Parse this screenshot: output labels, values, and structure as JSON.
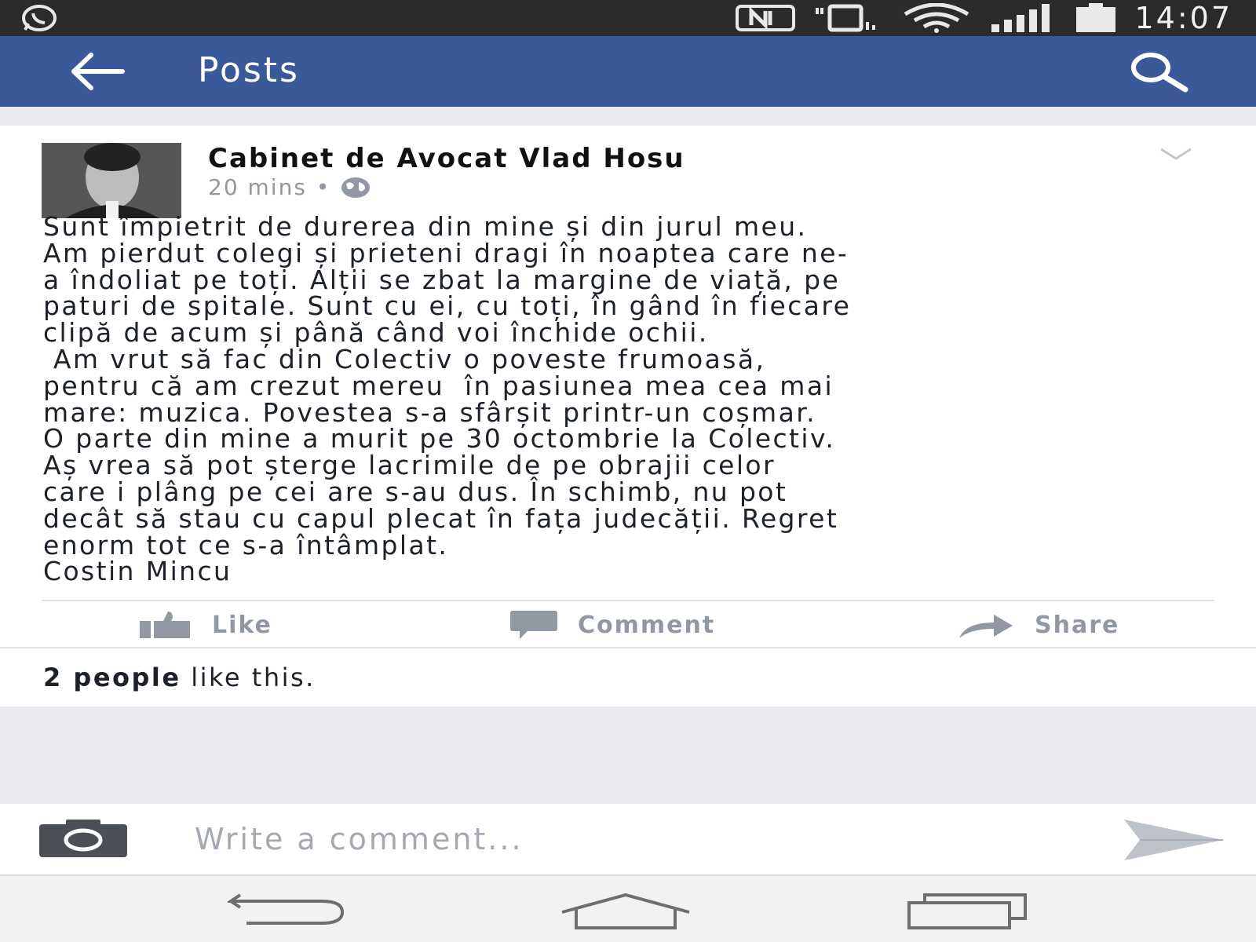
{
  "status_bar": {
    "time": "14:07",
    "icons": [
      "whatsapp-icon",
      "nfc-icon",
      "vibrate-icon",
      "wifi-icon",
      "signal-icon",
      "battery-icon"
    ]
  },
  "app_bar": {
    "title": "Posts",
    "color": "#3b5998"
  },
  "post": {
    "author": "Cabinet de Avocat Vlad Hosu",
    "time": "20 mins",
    "separator": "•",
    "body_lines": [
      "Sunt împietrit de durerea din mine și din jurul meu.",
      "Am pierdut colegi și prieteni dragi în noaptea care ne-",
      "a îndoliat pe toți. Alții se zbat la margine de viață, pe",
      "paturi de spitale. Sunt cu ei, cu toți, în gând în fiecare",
      "clipă de acum și până când voi închide ochii.",
      " Am vrut să fac din Colectiv o poveste frumoasă,",
      "pentru că am crezut mereu  în pasiunea mea cea mai",
      "mare: muzica. Povestea s-a sfârșit printr-un coșmar.",
      "O parte din mine a murit pe 30 octombrie la Colectiv.",
      "Aș vrea să pot șterge lacrimile de pe obrajii celor",
      "care i plâng pe cei are s-au dus. În schimb, nu pot",
      "decât să stau cu capul plecat în fața judecății. Regret",
      "enorm tot ce s-a întâmplat.",
      "Costin Mincu"
    ],
    "actions": {
      "like": "Like",
      "comment": "Comment",
      "share": "Share"
    },
    "likes_summary": {
      "count_text": "2 people",
      "suffix": " like this."
    }
  },
  "composer": {
    "placeholder": "Write a comment..."
  }
}
